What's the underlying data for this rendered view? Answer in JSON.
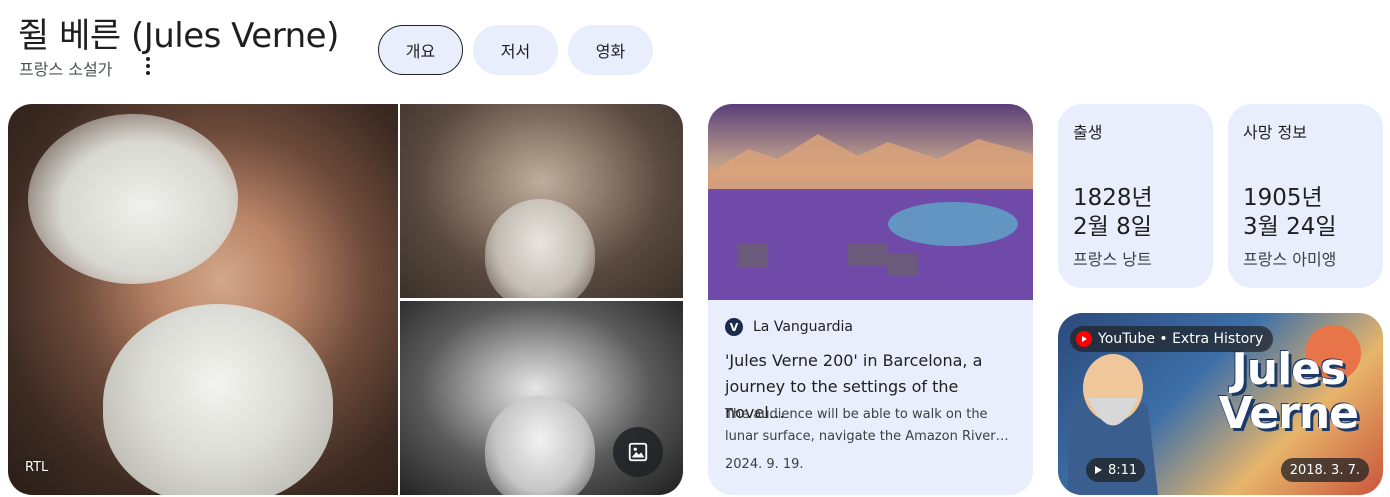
{
  "header": {
    "title": "쥘 베른 (Jules Verne)",
    "subtitle": "프랑스 소설가"
  },
  "tabs": [
    {
      "label": "개요",
      "active": true
    },
    {
      "label": "저서",
      "active": false
    },
    {
      "label": "영화",
      "active": false
    }
  ],
  "gallery": {
    "credit": "RTL"
  },
  "news": {
    "source": "La Vanguardia",
    "source_initial": "V",
    "headline": "'Jules Verne 200' in Barcelona, a journey to the settings of the novel…",
    "description": "The audience will be able to walk on the lunar surface, navigate the Amazon River…",
    "date": "2024. 9. 19."
  },
  "facts": {
    "birth": {
      "label": "출생",
      "date_line1": "1828년",
      "date_line2": "2월 8일",
      "place": "프랑스 낭트"
    },
    "death": {
      "label": "사망 정보",
      "date_line1": "1905년",
      "date_line2": "3월 24일",
      "place": "프랑스 아미앵"
    }
  },
  "video": {
    "source": "YouTube • Extra History",
    "art_line1": "Jules",
    "art_line2": "Verne",
    "duration": "8:11",
    "date": "2018. 3. 7."
  },
  "colors": {
    "card_bg": "#e8eefc",
    "text": "#1f1f1f",
    "youtube_red": "#ff0000"
  },
  "icons": [
    "more-vert-icon",
    "image-gallery-icon",
    "youtube-icon",
    "play-icon"
  ]
}
